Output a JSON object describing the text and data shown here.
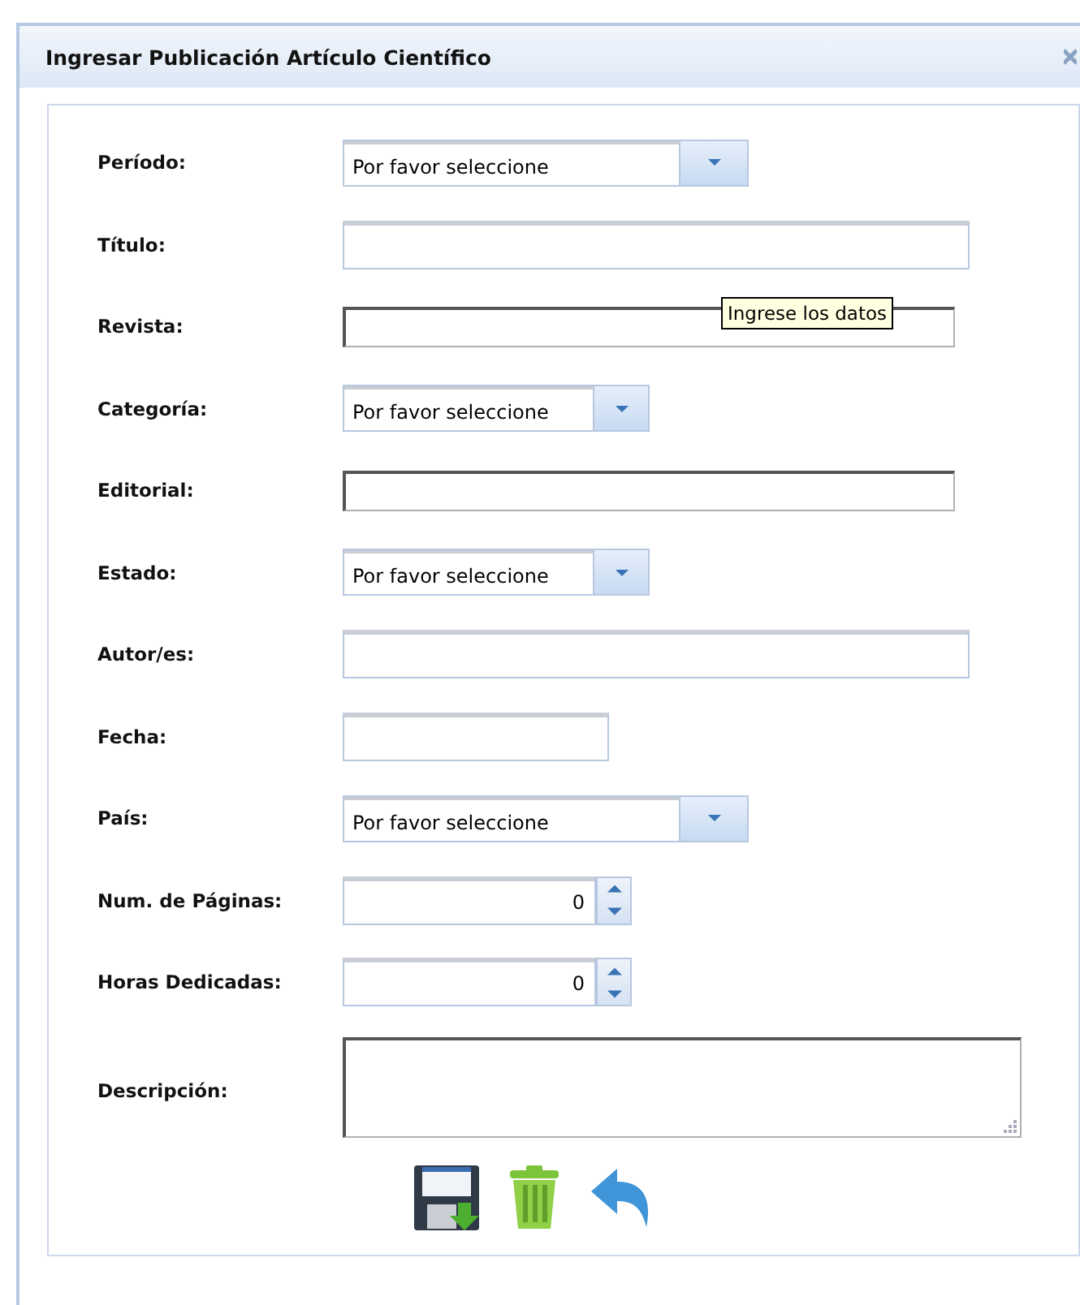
{
  "window": {
    "title": "Ingresar Publicación Artículo Científico"
  },
  "fields": [
    {
      "label": "Período:",
      "kind": "combo",
      "value": "Por favor seleccione"
    },
    {
      "label": "Título:",
      "kind": "text"
    },
    {
      "label": "Revista:",
      "kind": "sunken",
      "tooltip": "Ingrese los datos"
    },
    {
      "label": "Categoría:",
      "kind": "combo",
      "value": "Por favor seleccione"
    },
    {
      "label": "Editorial:",
      "kind": "sunken"
    },
    {
      "label": "Estado:",
      "kind": "combo",
      "value": "Por favor seleccione"
    },
    {
      "label": "Autor/es:",
      "kind": "text"
    },
    {
      "label": "Fecha:",
      "kind": "text"
    },
    {
      "label": "País:",
      "kind": "combo",
      "value": "Por favor seleccione"
    },
    {
      "label": "Num. de Páginas:",
      "kind": "spinner",
      "value": "0"
    },
    {
      "label": "Horas Dedicadas:",
      "kind": "spinner",
      "value": "0"
    },
    {
      "label": "Descripción:",
      "kind": "textarea"
    }
  ],
  "actions": [
    {
      "kind": "save"
    },
    {
      "kind": "delete"
    },
    {
      "kind": "back"
    }
  ]
}
